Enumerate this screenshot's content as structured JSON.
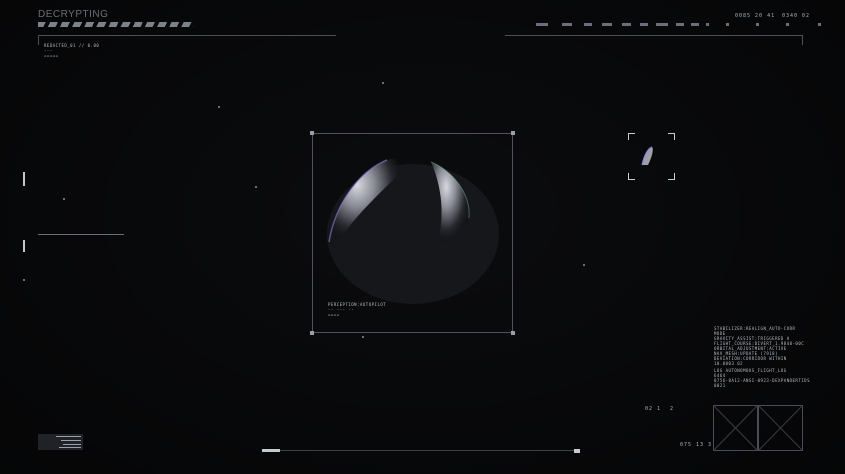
{
  "hud": {
    "title": "DECRYPTING",
    "top_left_info": [
      "REDACTED_01  //  0.00",
      "---",
      "====="
    ],
    "top_right_code_a": "0085  20 41",
    "top_right_code_b": "0340 02",
    "top_right_ticks": [
      "2",
      "3",
      "3",
      "3"
    ],
    "frame_caption": [
      "PERCEPTION:AUTOPILOT",
      "-- --- --",
      "===="
    ],
    "status_block": [
      "STABILIZER:REALIGN_AUTO-CORR",
      "MODE",
      "GRAVITY_ASSIST:TRIGGERED A",
      "FLIGHT_COURSE:DIVERT_1.9840-00C",
      "ORBITAL_ADJUSTMENT:ACTIVE",
      "NAV_MESH:UPDATE (7918)",
      "DEVIATION:CORRIDOR WITHIN",
      "10.0003 02"
    ],
    "status_log": [
      "LOG AUTONOMOUS_FLIGHT_LOG",
      "6464",
      "0756-8A12-ANSI-0923-DEXPANDERTIDS",
      "0021"
    ],
    "bottom_right_code": "02 1",
    "bottom_right_code_b": "2",
    "bottom_right_code_c": "075 13",
    "bottom_right_code_d": "3"
  },
  "colors": {
    "background": "#0b0c0e",
    "hud_line": "#4c4f56",
    "hud_text": "#c9ccd3"
  }
}
